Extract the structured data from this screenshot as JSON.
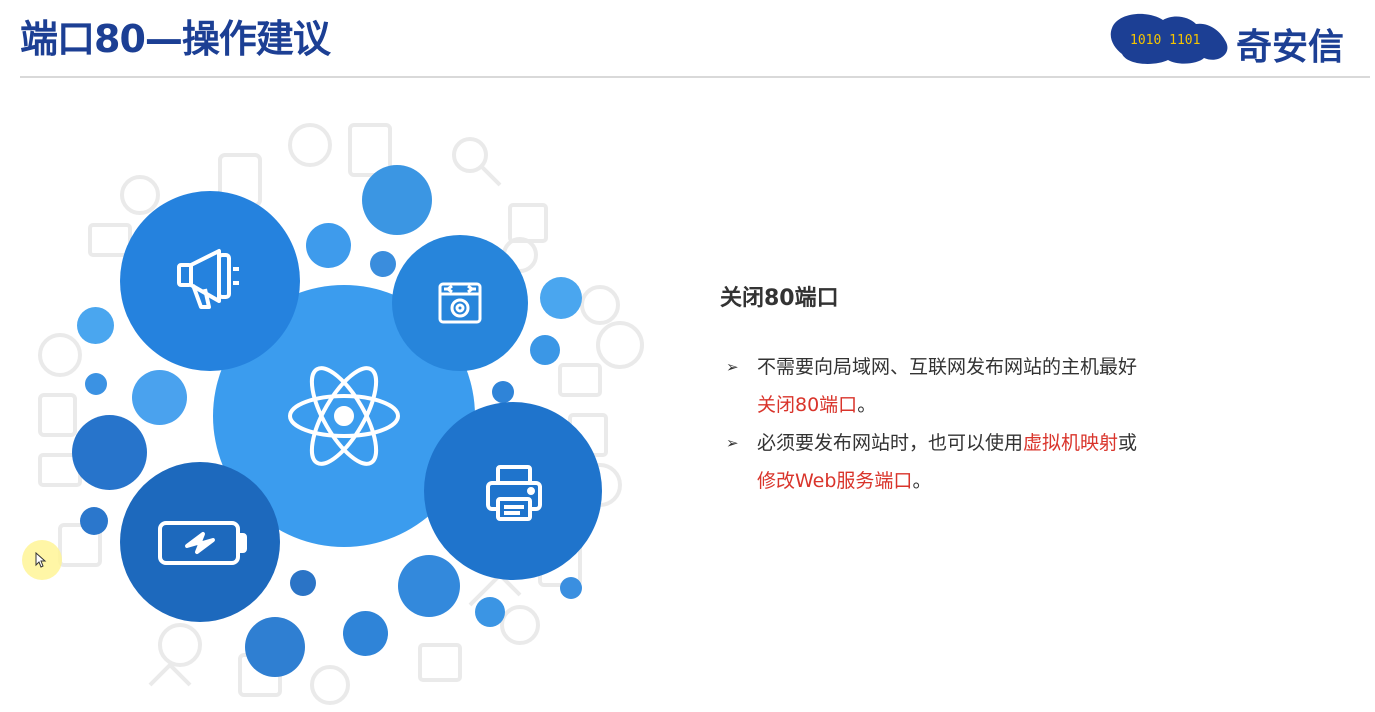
{
  "header": {
    "title": "端口80—操作建议",
    "logo_text": "奇安信",
    "logo_digits": "1010 1101"
  },
  "main": {
    "subheading": "关闭80端口",
    "bullets": [
      {
        "marker": "➢",
        "parts": [
          {
            "text": "不需要向局域网、互联网发布网站的主机最好",
            "red": false
          },
          {
            "text": "关闭80端口",
            "red": true
          },
          {
            "text": "。",
            "red": false
          }
        ]
      },
      {
        "marker": "➢",
        "parts": [
          {
            "text": "必须要发布网站时，也可以使用",
            "red": false
          },
          {
            "text": "虚拟机映射",
            "red": true
          },
          {
            "text": "或",
            "red": false
          },
          {
            "text": "修改Web服务端口",
            "red": true
          },
          {
            "text": "。",
            "red": false
          }
        ]
      }
    ]
  },
  "illustration": {
    "icons": [
      "megaphone-icon",
      "camera-icon",
      "atom-icon",
      "printer-icon",
      "battery-icon"
    ],
    "colors": {
      "dark_blue": "#1f6fc7",
      "mid_blue": "#2d87df",
      "light_blue": "#45a3ee",
      "pale_icons": "#eeeeee",
      "title_blue": "#1c3f94",
      "highlight_red": "#d9342b"
    }
  }
}
